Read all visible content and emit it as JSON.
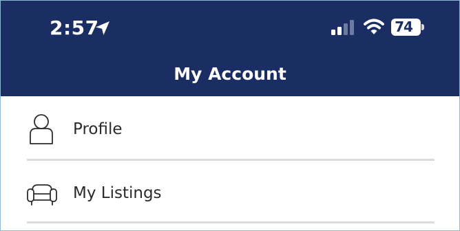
{
  "status_bar": {
    "time": "2:57",
    "battery_level": "74",
    "icons": [
      "location-arrow-icon",
      "cellular-signal-icon",
      "wifi-icon",
      "battery-icon"
    ]
  },
  "header": {
    "title": "My Account",
    "background_color": "#1b2e63"
  },
  "menu": {
    "items": [
      {
        "label": "Profile",
        "icon": "person-icon"
      },
      {
        "label": "My Listings",
        "icon": "sofa-icon"
      }
    ]
  }
}
